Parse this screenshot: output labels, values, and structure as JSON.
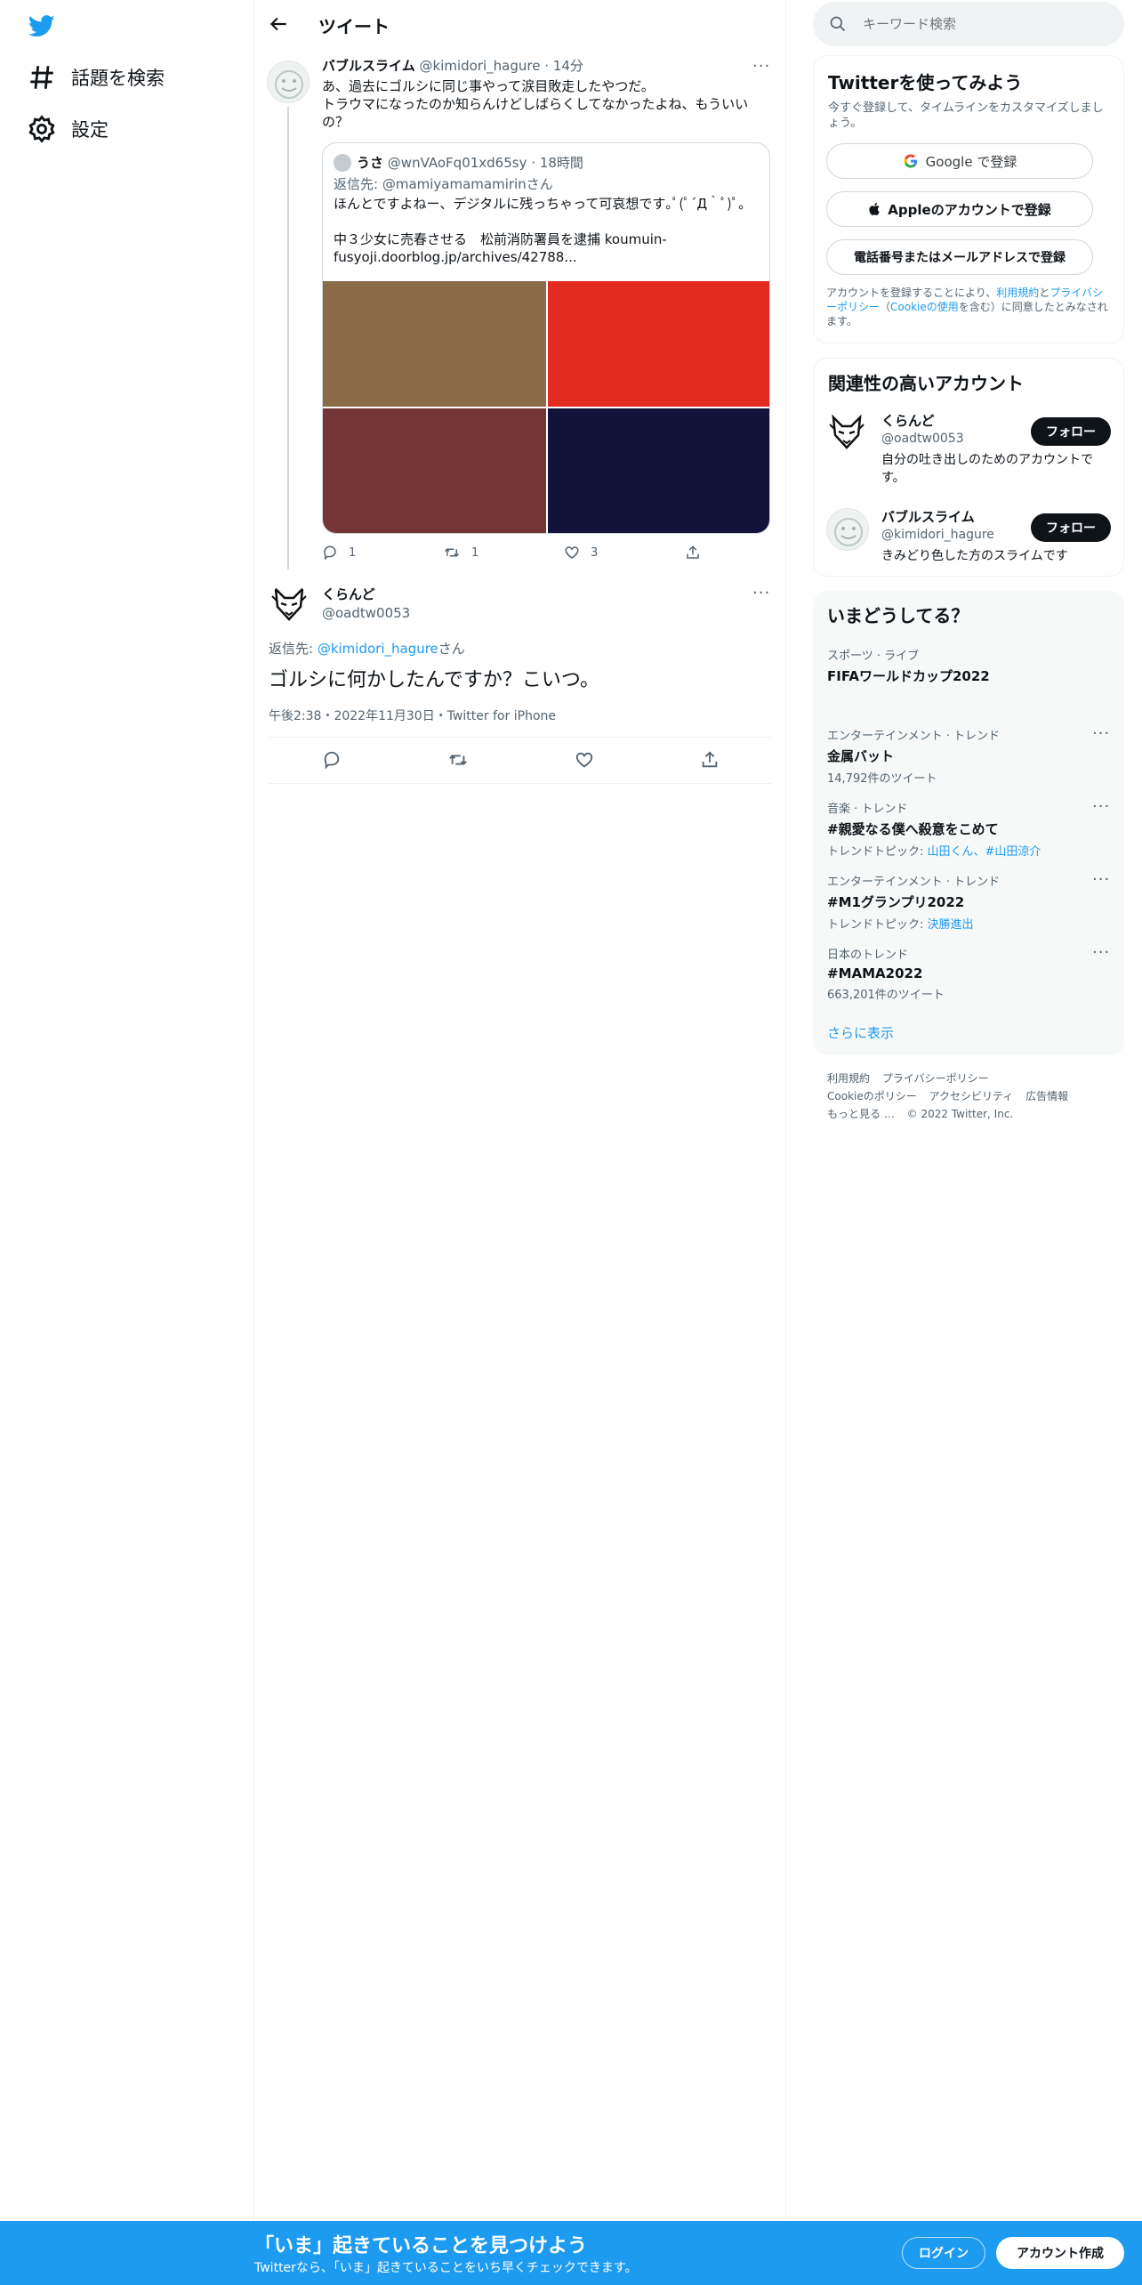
{
  "sidebar": {
    "items": [
      {
        "label": "話題を検索",
        "icon": "hashtag-icon"
      },
      {
        "label": "設定",
        "icon": "gear-icon"
      }
    ]
  },
  "header": {
    "title": "ツイート"
  },
  "parent_tweet": {
    "name": "バブルスライム",
    "handle": "@kimidori_hagure",
    "dot": "·",
    "time": "14分",
    "text_lines": [
      "あ、過去にゴルシに同じ事やって涙目敗走したやつだ。",
      "トラウマになったのか知らんけどしばらくしてなかったよね、もういいの？"
    ],
    "quote": {
      "name": "うさ",
      "handle": "@wnVAoFq01xd65sy",
      "time": "18時間",
      "reply_prefix": "返信先: ",
      "reply_to": "@mamiyamamamirin",
      "reply_suffix": "さん",
      "text1": "ほんとですよねー、デジタルに残っちゃって可哀想です｡ﾟ(ﾟ´Д｀ﾟ)ﾟ｡",
      "text2": "中３少女に売春させる　松前消防署員を逮捕 koumuin-",
      "text3": "fusyoji.doorblog.jp/archives/42788...",
      "image_colors": [
        "#8b6a48",
        "#e22b21",
        "#733535",
        "#12123a"
      ]
    },
    "actions": {
      "replies": "1",
      "retweets": "1",
      "likes": "3"
    }
  },
  "main_tweet": {
    "name": "くらんど",
    "handle": "@oadtw0053",
    "reply_prefix": "返信先: ",
    "reply_to": "@kimidori_hagure",
    "reply_suffix": "さん",
    "text": "ゴルシに何かしたんですか？こいつ。",
    "meta": "午後2:38・2022年11月30日・Twitter for iPhone"
  },
  "search": {
    "placeholder": "キーワード検索"
  },
  "signup": {
    "title": "Twitterを使ってみよう",
    "subtitle": "今すぐ登録して、タイムラインをカスタマイズしましょう。",
    "google": "Google で登録",
    "apple": "Appleのアカウントで登録",
    "phone": "電話番号またはメールアドレスで登録",
    "legal_1": "アカウントを登録することにより、",
    "legal_terms": "利用規約",
    "legal_2": "と",
    "legal_privacy": "プライバシーポリシー",
    "legal_3": "（",
    "legal_cookie": "Cookieの使用",
    "legal_4": "を含む）に同意したとみなされます。"
  },
  "related": {
    "title": "関連性の高いアカウント",
    "follow_label": "フォロー",
    "accounts": [
      {
        "name": "くらんど",
        "handle": "@oadtw0053",
        "bio": "自分の吐き出しのためのアカウントです。"
      },
      {
        "name": "バブルスライム",
        "handle": "@kimidori_hagure",
        "bio": "きみどり色した方のスライムです"
      }
    ]
  },
  "trends": {
    "title": "いまどうしてる？",
    "items": [
      {
        "category": "スポーツ · ライブ",
        "title": "FIFAワールドカップ2022",
        "sub": ""
      },
      {
        "category": "エンターテインメント · トレンド",
        "title": "金属バット",
        "sub": "14,792件のツイート"
      },
      {
        "category": "音楽 · トレンド",
        "title": "#親愛なる僕へ殺意をこめて",
        "sub_prefix": "トレンドトピック: ",
        "sub_link": "山田くん、#山田涼介"
      },
      {
        "category": "エンターテインメント · トレンド",
        "title": "#M1グランプリ2022",
        "sub_prefix": "トレンドトピック: ",
        "sub_link": "決勝進出"
      },
      {
        "category": "日本のトレンド",
        "title": "#MAMA2022",
        "sub": "663,201件のツイート"
      }
    ],
    "more": "さらに表示"
  },
  "footer": {
    "links": [
      "利用規約",
      "プライバシーポリシー",
      "Cookieのポリシー",
      "アクセシビリティ",
      "広告情報",
      "もっと見る …"
    ],
    "copyright": "© 2022 Twitter, Inc."
  },
  "bottom_bar": {
    "title": "「いま」起きていることを見つけよう",
    "subtitle": "Twitterなら、「いま」起きていることをいち早くチェックできます。",
    "login": "ログイン",
    "signup": "アカウント作成"
  },
  "colors": {
    "accent": "#1d9bf0",
    "dark": "#0f1419",
    "muted": "#536471"
  }
}
